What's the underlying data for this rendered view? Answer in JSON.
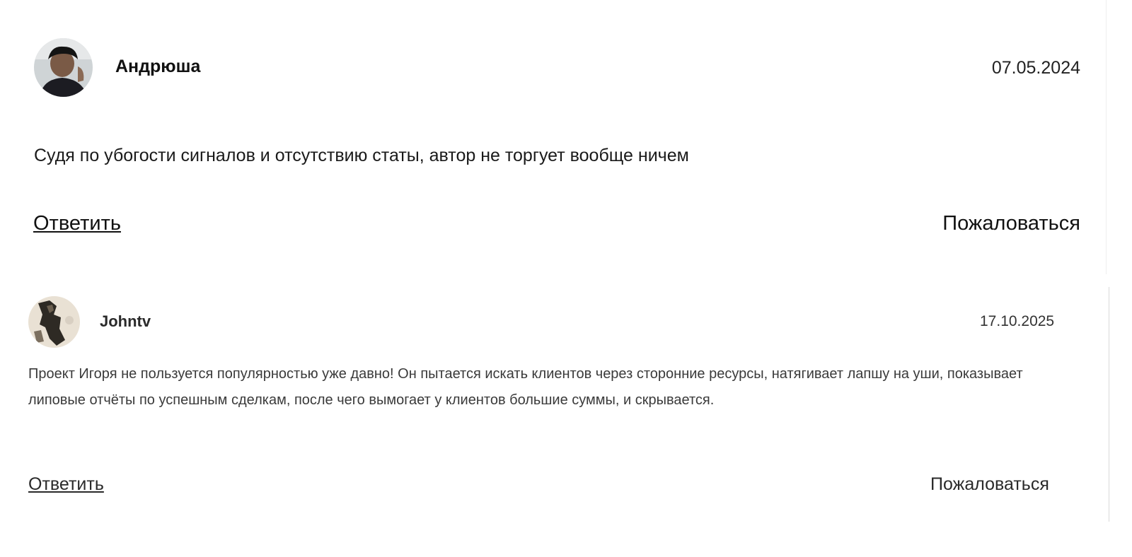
{
  "comments": [
    {
      "author": "Андрюша",
      "date": "07.05.2024",
      "text": "Судя по убогости сигналов и отсутствию статы, автор не торгует вообще ничем",
      "reply_label": "Ответить",
      "report_label": "Пожаловаться",
      "avatar_icon": "user-photo-avatar"
    },
    {
      "author": "Johntv",
      "date": "17.10.2025",
      "text": "Проект Игоря не пользуется популярностью уже давно! Он пытается искать клиентов через сторонние ресурсы, натягивает лапшу на уши, показывает липовые отчёты по успешным сделкам, после чего вымогает у клиентов большие суммы, и скрывается.",
      "reply_label": "Ответить",
      "report_label": "Пожаловаться",
      "avatar_icon": "user-photo-avatar"
    }
  ],
  "colors": {
    "text": "#111111",
    "background": "#ffffff"
  }
}
